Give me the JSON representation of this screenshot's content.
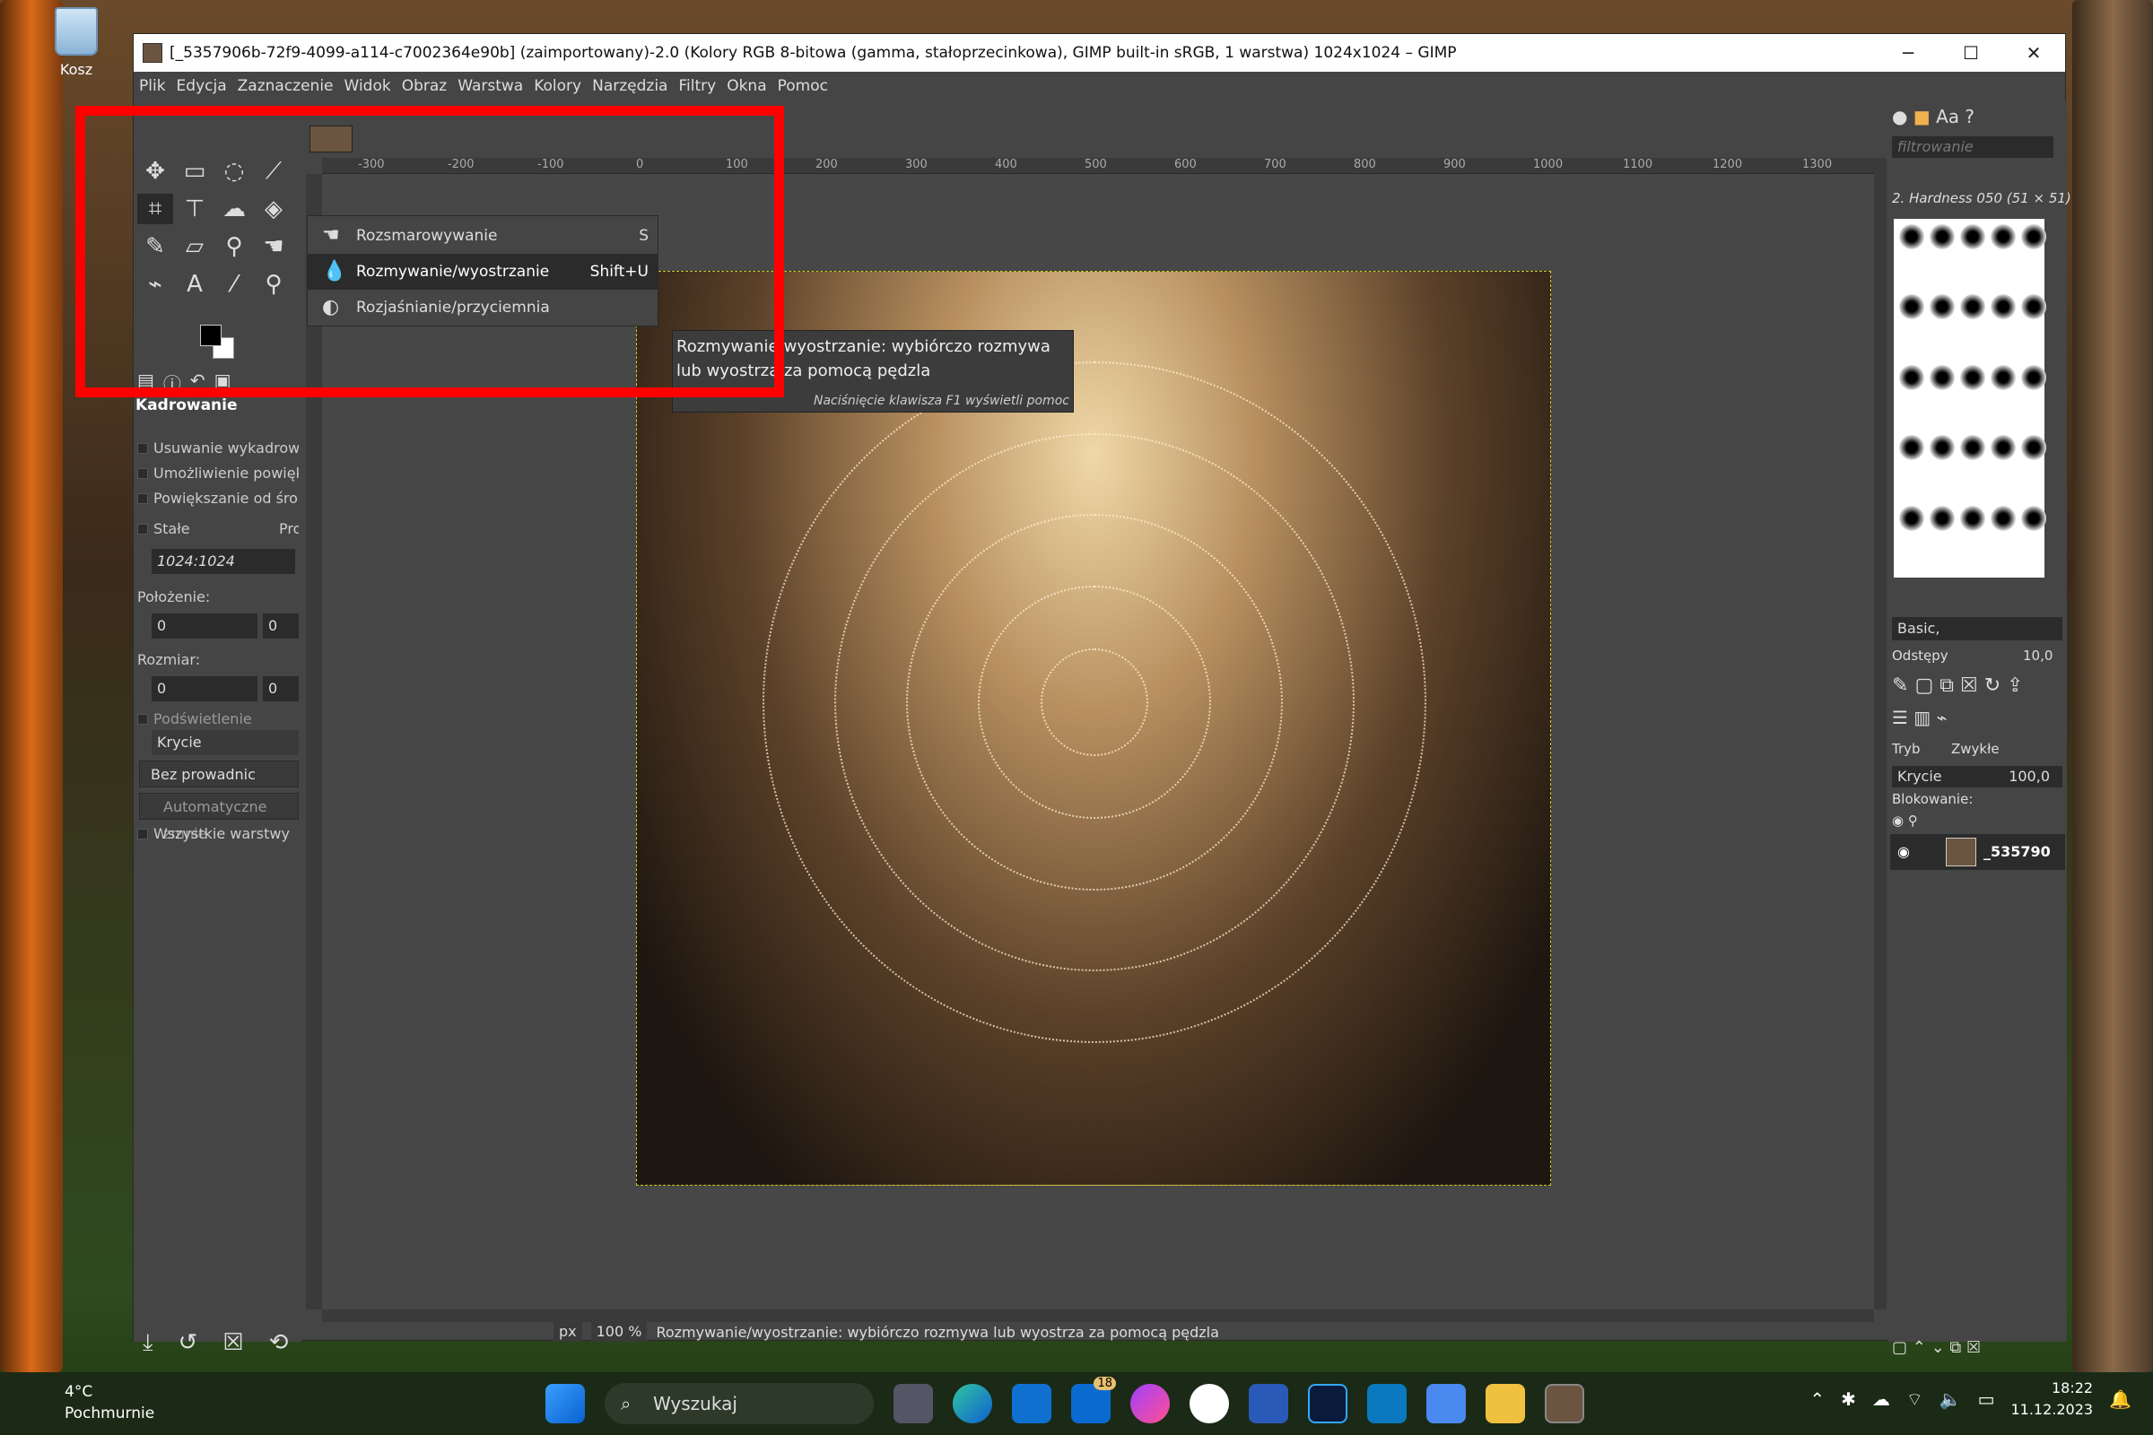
{
  "desktop": {
    "recycle_bin_label": "Kosz"
  },
  "window": {
    "title": "[_5357906b-72f9-4099-a114-c7002364e90b] (zaimportowany)-2.0 (Kolory RGB 8-bitowa (gamma, stałoprzecinkowa), GIMP built-in sRGB, 1 warstwa) 1024x1024 – GIMP",
    "minimize": "─",
    "maximize": "☐",
    "close": "✕"
  },
  "menu": [
    "Plik",
    "Edycja",
    "Zaznaczenie",
    "Widok",
    "Obraz",
    "Warstwa",
    "Kolory",
    "Narzędzia",
    "Filtry",
    "Okna",
    "Pomoc"
  ],
  "toolbox": {
    "tool_options_title": "Kadrowanie",
    "options": {
      "delete_cropped": "Usuwanie wykadrowan",
      "allow_growing": "Umożliwienie powiększ",
      "expand_from_center": "Powiększanie od środk",
      "fixed": "Stałe",
      "fixed_mode": "Pro",
      "aspect_value": "1024:1024",
      "position_label": "Położenie:",
      "position_x": "0",
      "position_y": "0",
      "size_label": "Rozmiar:",
      "size_x": "0",
      "size_y": "0",
      "highlight": "Podświetlenie",
      "highlight_opacity": "Krycie podświetlenia",
      "guides": "Bez prowadnic",
      "auto_shrink": "Automatyczne zmnie",
      "all_layers": "Wszystkie warstwy"
    }
  },
  "popup_menu": {
    "items": [
      {
        "label": "Rozsmarowywanie",
        "shortcut": "S"
      },
      {
        "label": "Rozmywanie/wyostrzanie",
        "shortcut": "Shift+U"
      },
      {
        "label": "Rozjaśnianie/przyciemnia",
        "shortcut": ""
      }
    ]
  },
  "tooltip": {
    "text": "Rozmywanie/wyostrzanie: wybiórczo rozmywa lub wyostrza za pomocą pędzla",
    "hint": "Naciśnięcie klawisza F1 wyświetli pomoc"
  },
  "ruler_labels": [
    "-300",
    "-200",
    "-100",
    "0",
    "100",
    "200",
    "300",
    "400",
    "500",
    "600",
    "700",
    "800",
    "900",
    "1000",
    "1100",
    "1200",
    "1300"
  ],
  "statusbar": {
    "unit": "px",
    "zoom": "100 %",
    "message": "Rozmywanie/wyostrzanie: wybiórczo rozmywa lub wyostrza za pomocą pędzla"
  },
  "dock": {
    "filter_placeholder": "filtrowanie",
    "brush_name": "2. Hardness 050 (51 × 51)",
    "brush_tag": "Basic,",
    "spacing_label": "Odstępy",
    "spacing_value": "10,0",
    "mode_label": "Tryb",
    "mode_value": "Zwykłe",
    "opacity_label": "Krycie",
    "opacity_value": "100,0",
    "lock_label": "Blokowanie:",
    "layer_name": "_535790"
  },
  "taskbar": {
    "weather_temp": "4°C",
    "weather_desc": "Pochmurnie",
    "search_label": "Wyszukaj",
    "mail_badge": "18",
    "time": "18:22",
    "date": "11.12.2023"
  },
  "colors": {
    "highlight_box": "#ff0000",
    "gimp_bg": "#454545"
  }
}
